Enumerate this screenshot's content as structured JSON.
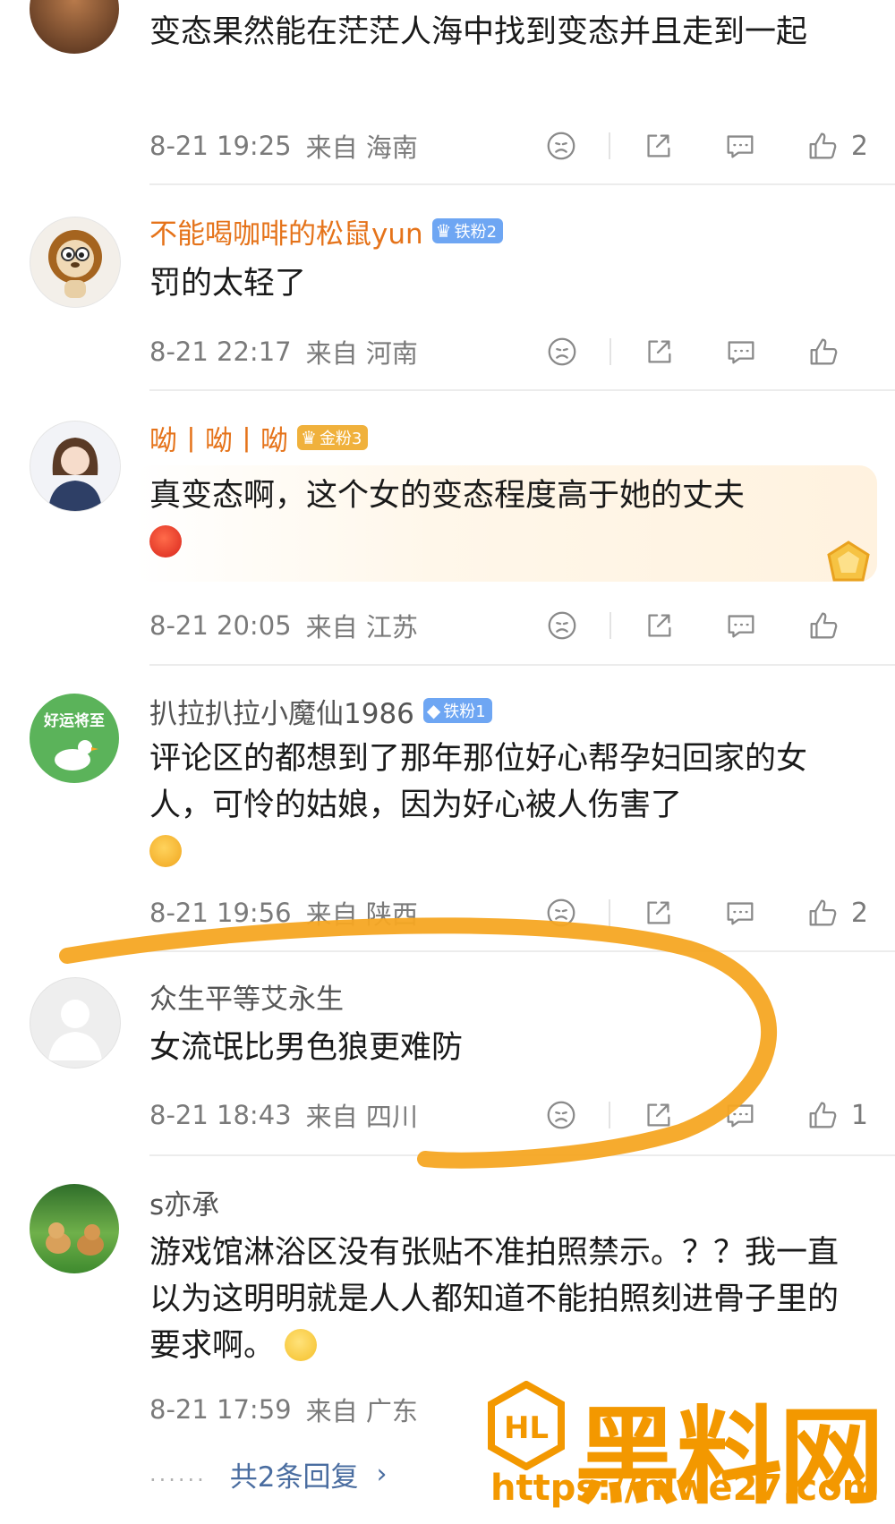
{
  "colors": {
    "accent_name": "#e5731a",
    "badge_blue": "#6ea6f3",
    "badge_gold": "#f0b13c",
    "meta": "#7a7a7a",
    "link": "#4a6da0",
    "watermark": "#f39800",
    "scribble": "#f5a623"
  },
  "comments": [
    {
      "text": "变态果然能在茫茫人海中找到变态并且走到一起",
      "time": "8-21 19:25",
      "from": "来自",
      "location": "海南",
      "likes": "2"
    },
    {
      "name": "不能喝咖啡的松鼠yun",
      "badge": "铁粉2",
      "text": "罚的太轻了",
      "time": "8-21 22:17",
      "from": "来自",
      "location": "河南",
      "likes": ""
    },
    {
      "name": "呦丨呦丨呦",
      "badge": "金粉3",
      "text": "真变态啊，这个女的变态程度高于她的丈夫",
      "emoji": "angry-face",
      "time": "8-21 20:05",
      "from": "来自",
      "location": "江苏",
      "likes": ""
    },
    {
      "name": "扒拉扒拉小魔仙1986",
      "badge": "铁粉1",
      "avatar_text": "好运将至",
      "text": "评论区的都想到了那年那位好心帮孕妇回家的女人，可怜的姑娘，因为好心被人伤害了",
      "emoji": "crying-face",
      "time": "8-21 19:56",
      "from": "来自",
      "location": "陕西",
      "likes": "2"
    },
    {
      "name": "众生平等艾永生",
      "text": "女流氓比男色狼更难防",
      "time": "8-21 18:43",
      "from": "来自",
      "location": "四川",
      "likes": "1"
    },
    {
      "name": "s亦承",
      "text": "游戏馆淋浴区没有张贴不准拍照禁示。？？我一直以为这明明就是人人都知道不能拍照刻进骨子里的要求啊。",
      "emoji": "smile-face",
      "time": "8-21 17:59",
      "from": "来自",
      "location": "广东",
      "likes": ""
    }
  ],
  "replies": {
    "dots": "......",
    "label": "共2条回复",
    "chevron": "›"
  },
  "icons": [
    "dislike-icon",
    "share-icon",
    "comment-icon",
    "like-icon"
  ],
  "watermark": {
    "title": "黑料网",
    "url": "https://hlwe27.com",
    "logo": "HL"
  }
}
